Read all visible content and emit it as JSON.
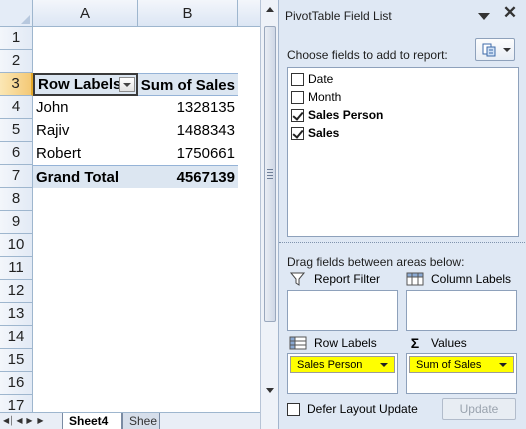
{
  "sheet": {
    "columns": [
      "A",
      "B"
    ],
    "rows": [
      "1",
      "2",
      "3",
      "4",
      "5",
      "6",
      "7",
      "8",
      "9",
      "10",
      "11",
      "12",
      "13",
      "14",
      "15",
      "16",
      "17"
    ],
    "pivot": {
      "header": {
        "row_labels": "Row Labels",
        "values": "Sum of Sales"
      },
      "data": [
        {
          "label": "John",
          "value": "1328135"
        },
        {
          "label": "Rajiv",
          "value": "1488343"
        },
        {
          "label": "Robert",
          "value": "1750661"
        }
      ],
      "total": {
        "label": "Grand Total",
        "value": "4567139"
      }
    },
    "tabs": {
      "active": "Sheet4",
      "other": "Shee"
    }
  },
  "field_list": {
    "title": "PivotTable Field List",
    "choose_label": "Choose fields to add to report:",
    "fields": [
      {
        "name": "Date",
        "checked": false
      },
      {
        "name": "Month",
        "checked": false
      },
      {
        "name": "Sales Person",
        "checked": true
      },
      {
        "name": "Sales",
        "checked": true
      }
    ],
    "drag_label": "Drag fields between areas below:",
    "areas": {
      "report_filter": {
        "label": "Report Filter"
      },
      "column_labels": {
        "label": "Column Labels"
      },
      "row_labels": {
        "label": "Row Labels",
        "item": "Sales Person"
      },
      "values": {
        "label": "Values",
        "item": "Sum of Sales"
      }
    },
    "defer_label": "Defer Layout Update",
    "update_label": "Update"
  },
  "colors": {
    "pivot_header_bg": "#dce6f1",
    "highlight_yellow": "#ffff00",
    "selected_header": "#f4c976",
    "pane_bg": "#dfe8f4"
  }
}
